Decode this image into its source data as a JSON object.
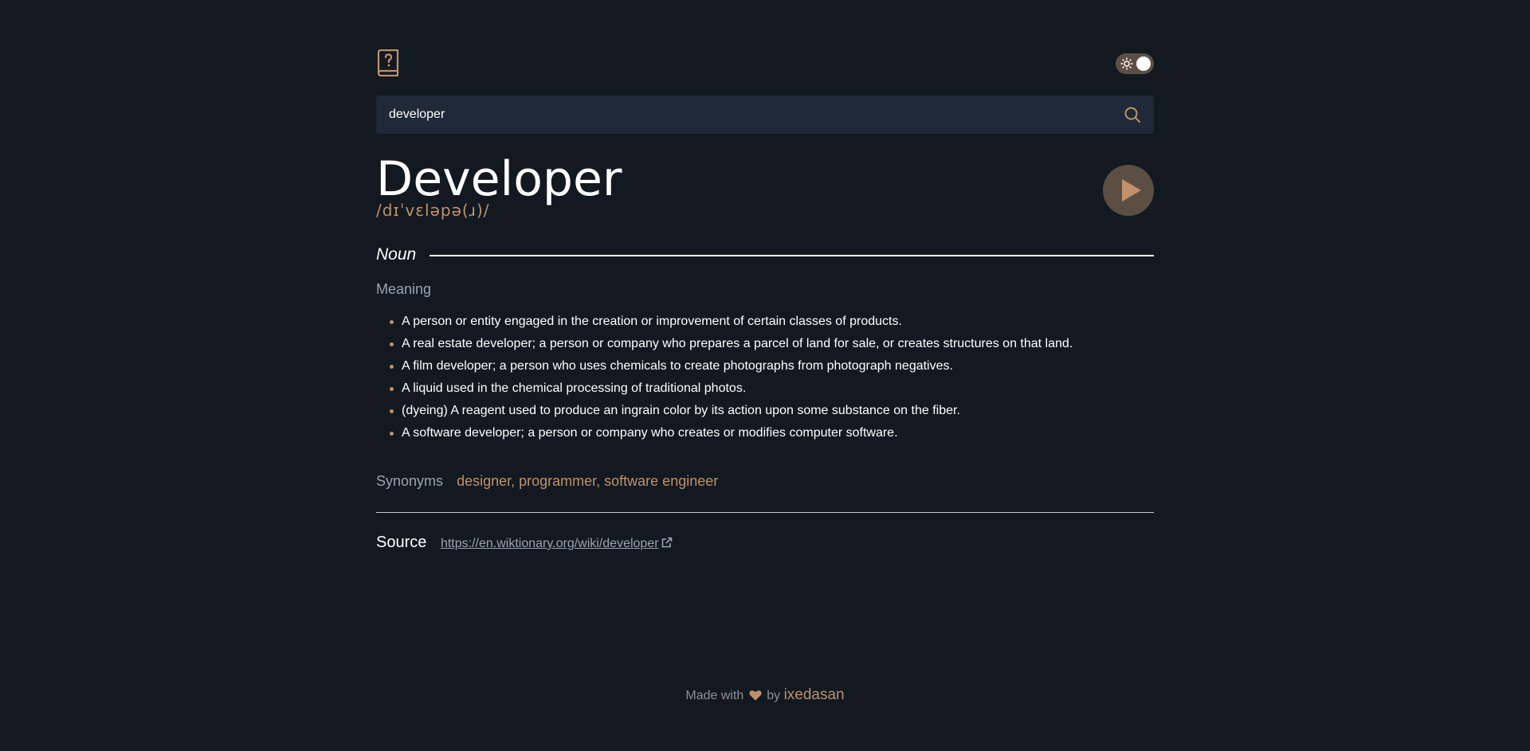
{
  "header": {
    "logo_icon": "book-question-icon",
    "theme_toggle_icon": "sun-icon"
  },
  "search": {
    "value": "developer",
    "icon": "search-icon"
  },
  "entry": {
    "word": "Developer",
    "phonetic": "/dɪˈvɛləpə(ɹ)/",
    "play_icon": "play-icon",
    "part_of_speech": "Noun",
    "meaning_label": "Meaning",
    "definitions": [
      "A person or entity engaged in the creation or improvement of certain classes of products.",
      "A real estate developer; a person or company who prepares a parcel of land for sale, or creates structures on that land.",
      "A film developer; a person who uses chemicals to create photographs from photograph negatives.",
      "A liquid used in the chemical processing of traditional photos.",
      "(dyeing) A reagent used to produce an ingrain color by its action upon some substance on the fiber.",
      "A software developer; a person or company who creates or modifies computer software."
    ],
    "synonyms_label": "Synonyms",
    "synonyms": "designer, programmer, software engineer"
  },
  "source": {
    "label": "Source",
    "url": "https://en.wiktionary.org/wiki/developer",
    "icon": "external-link-icon"
  },
  "footer": {
    "made_with": "Made with",
    "by": "by",
    "author": "ixedasan",
    "icon": "heart-icon"
  },
  "colors": {
    "background": "#121921",
    "accent": "#c0916a",
    "input_bg": "#1f2937",
    "muted": "#9ca3af"
  }
}
